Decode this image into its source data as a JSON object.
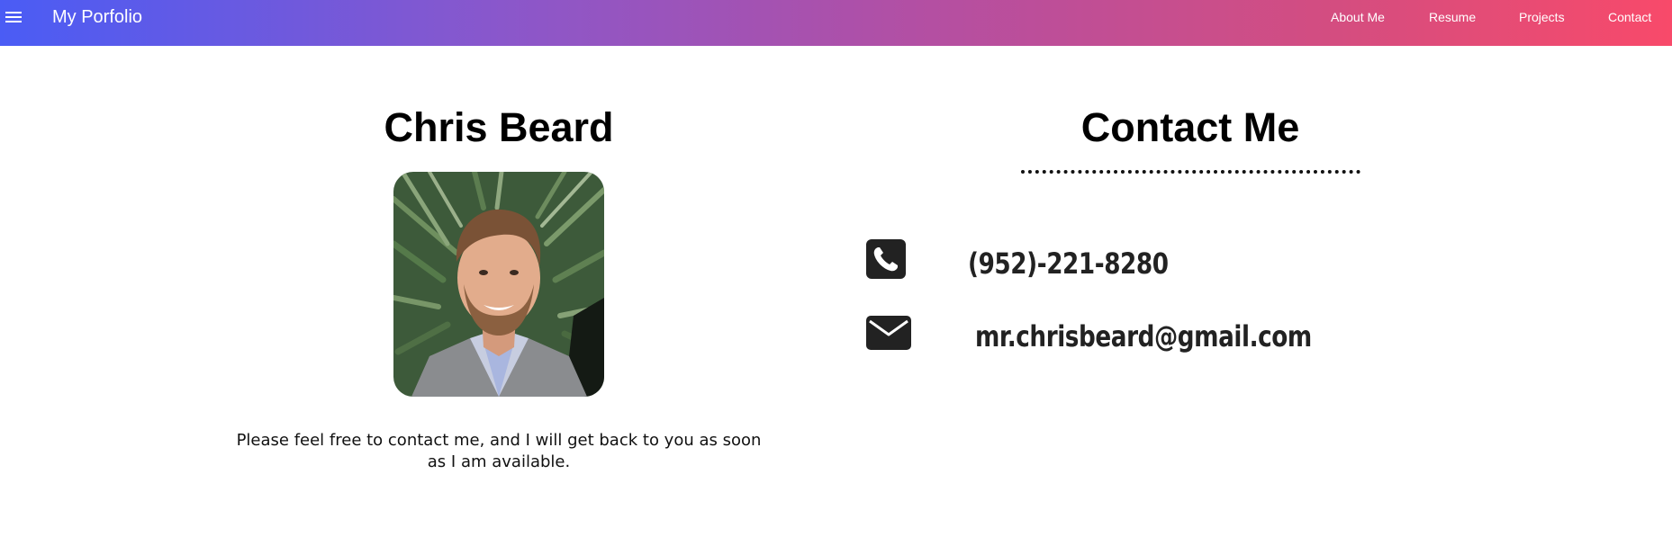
{
  "navbar": {
    "menu_icon": "hamburger-icon",
    "brand": "My Porfolio",
    "links": [
      {
        "label": "About Me"
      },
      {
        "label": "Resume"
      },
      {
        "label": "Projects"
      },
      {
        "label": "Contact"
      }
    ],
    "gradient_colors": [
      "#4a5cf5",
      "#b34fa3",
      "#f84a6a"
    ]
  },
  "profile": {
    "name": "Chris Beard",
    "photo": "profile-photo",
    "note": "Please feel free to contact me, and I will get back to you as soon as I am available."
  },
  "contact": {
    "heading": "Contact Me",
    "phone_icon": "phone-icon",
    "phone": "(952)-221-8280",
    "email_icon": "envelope-icon",
    "email": "mr.chrisbeard@gmail.com"
  }
}
